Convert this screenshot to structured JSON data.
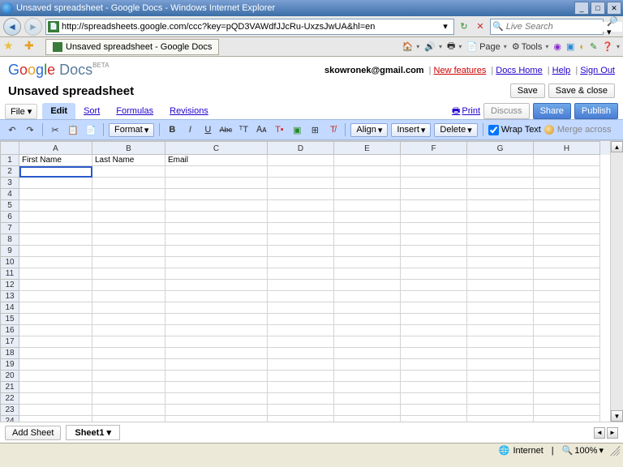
{
  "window": {
    "title": "Unsaved spreadsheet - Google Docs - Windows Internet Explorer"
  },
  "browser": {
    "url": "http://spreadsheets.google.com/ccc?key=pQD3VAWdfJJcRu-UxzsJwUA&hl=en",
    "search_placeholder": "Live Search",
    "tab_title": "Unsaved spreadsheet - Google Docs",
    "toolbar": {
      "home": "🏠",
      "feeds": "🔊",
      "print": "🖶",
      "page": "Page",
      "tools": "Tools"
    }
  },
  "gdocs": {
    "logo_g": "G",
    "logo_o1": "o",
    "logo_o2": "o",
    "logo_g2": "g",
    "logo_l": "l",
    "logo_e": "e",
    "logo_docs": "Docs",
    "logo_beta": "BETA",
    "email": "skowronek@gmail.com",
    "links": {
      "new_features": "New features",
      "docs_home": "Docs Home",
      "help": "Help",
      "sign_out": "Sign Out"
    },
    "doc_title": "Unsaved spreadsheet",
    "buttons": {
      "save": "Save",
      "save_close": "Save & close"
    },
    "file_menu": "File",
    "tabs": {
      "edit": "Edit",
      "sort": "Sort",
      "formulas": "Formulas",
      "revisions": "Revisions"
    },
    "actions": {
      "print": "Print",
      "discuss": "Discuss",
      "share": "Share",
      "publish": "Publish"
    },
    "toolbar": {
      "format": "Format",
      "align": "Align",
      "insert": "Insert",
      "delete": "Delete",
      "wrap": "Wrap Text",
      "merge": "Merge across",
      "bold": "B",
      "italic": "I",
      "underline": "U",
      "strike": "Abc"
    }
  },
  "spreadsheet": {
    "columns": [
      "A",
      "B",
      "C",
      "D",
      "E",
      "F",
      "G",
      "H"
    ],
    "row_count": 25,
    "data": {
      "1": {
        "A": "First Name",
        "B": "Last Name",
        "C": "Email"
      }
    },
    "active_cell": "A2"
  },
  "sheets": {
    "add": "Add Sheet",
    "tabs": [
      "Sheet1"
    ]
  },
  "status": {
    "zone": "Internet",
    "zoom": "100%"
  }
}
